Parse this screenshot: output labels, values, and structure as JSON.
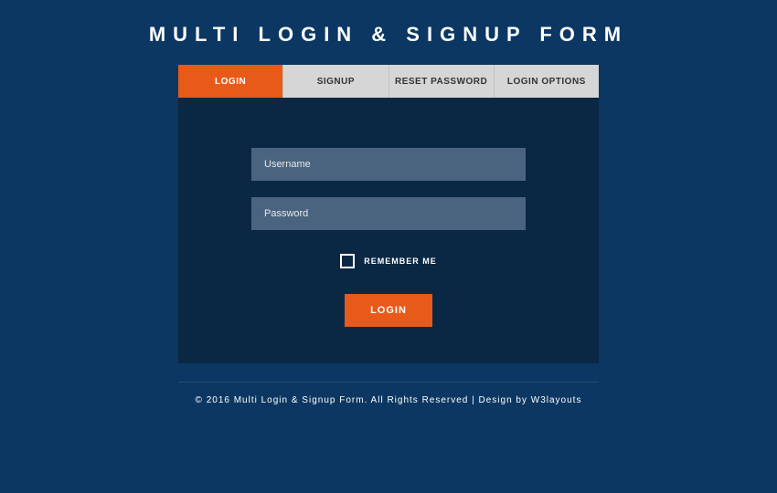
{
  "title": "MULTI LOGIN & SIGNUP FORM",
  "tabs": {
    "login": "LOGIN",
    "signup": "SIGNUP",
    "reset": "RESET PASSWORD",
    "options": "LOGIN OPTIONS"
  },
  "form": {
    "username_placeholder": "Username",
    "password_placeholder": "Password",
    "remember_label": "REMEMBER ME",
    "submit_label": "LOGIN"
  },
  "footer": "© 2016 Multi Login & Signup Form. All Rights Reserved | Design by W3layouts"
}
